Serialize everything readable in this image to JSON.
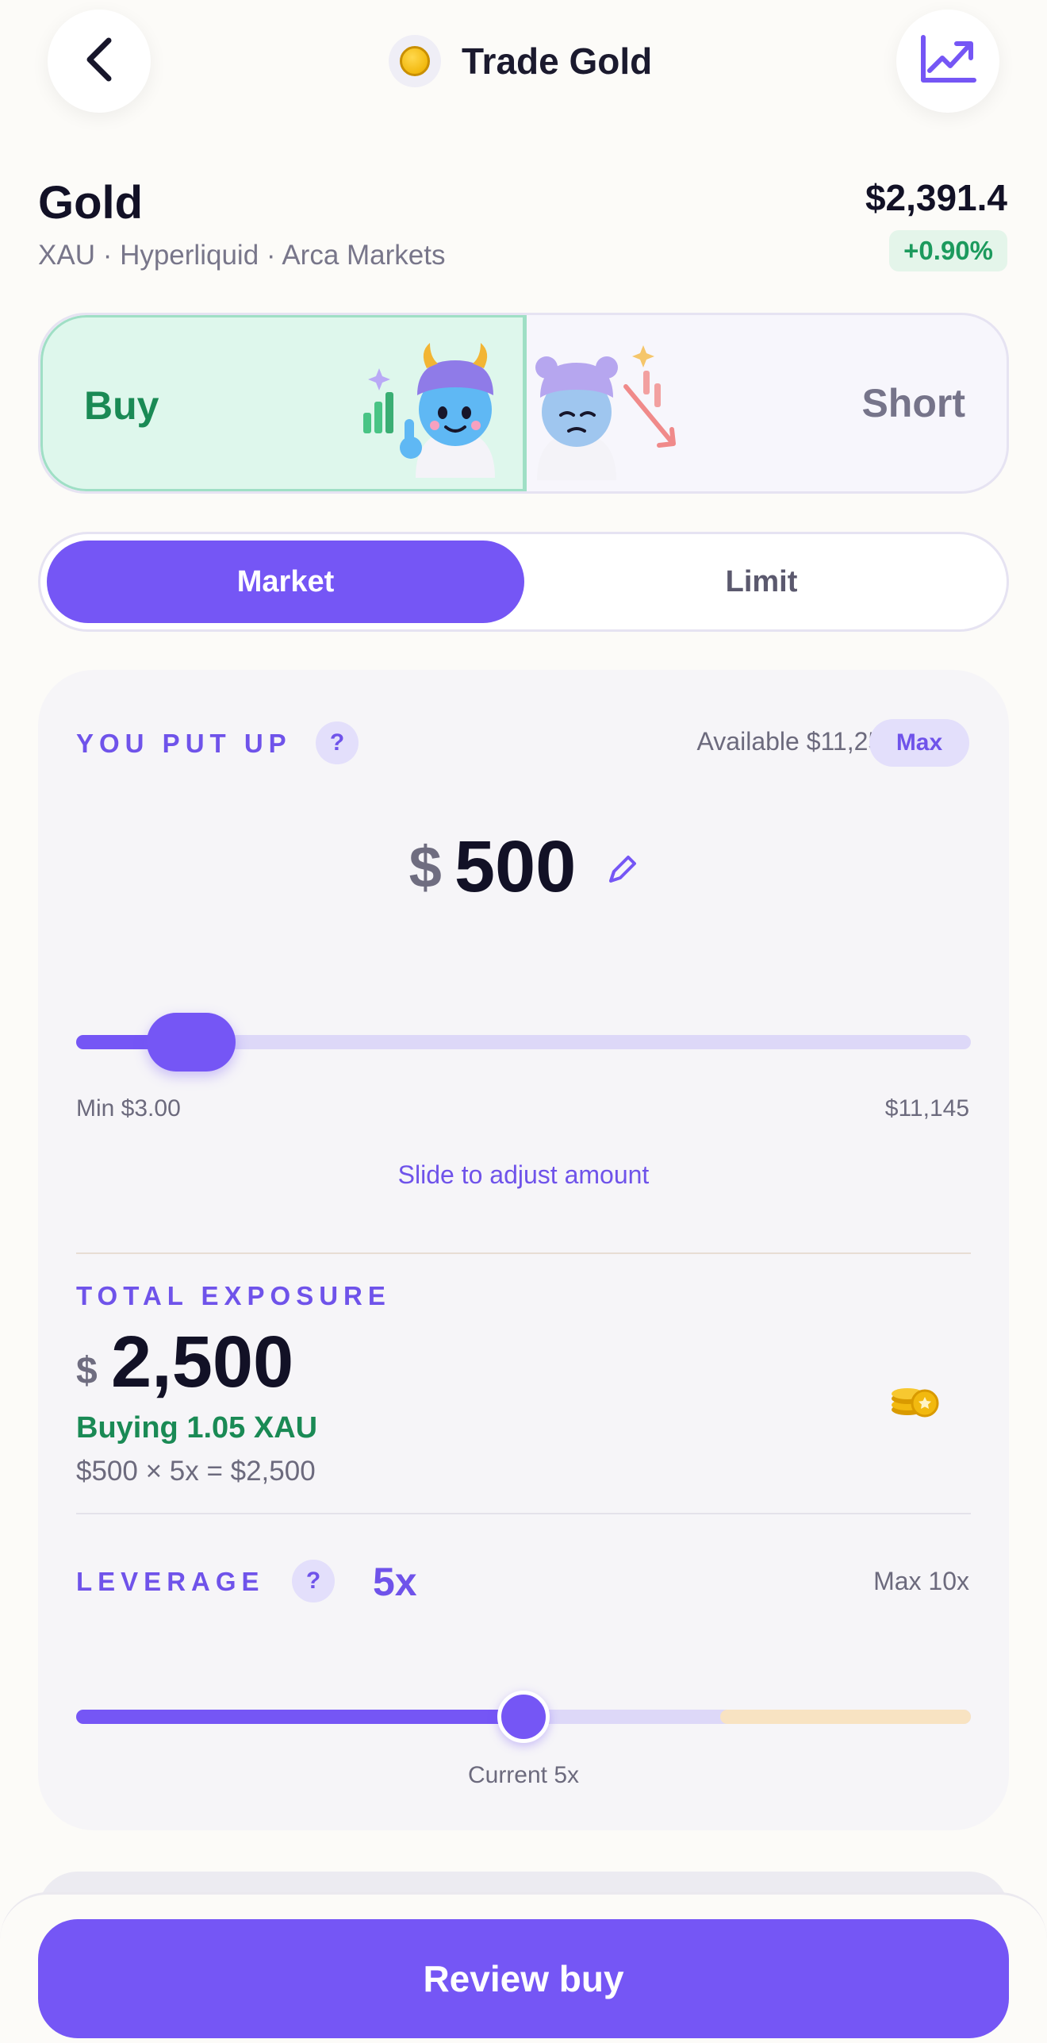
{
  "header": {
    "title": "Trade Gold",
    "back_icon": "chevron-left-icon",
    "chart_icon": "trending-up-icon",
    "coin_icon": "gold-coin-icon"
  },
  "asset": {
    "name": "Gold",
    "subtitle": "XAU · Hyperliquid · Arca Markets",
    "price": "$2,391.4",
    "change": "+0.90%"
  },
  "side_toggle": {
    "buy_label": "Buy",
    "short_label": "Short",
    "selected": "Buy"
  },
  "order_type": {
    "market_label": "Market",
    "limit_label": "Limit",
    "selected": "Market"
  },
  "put_up": {
    "label": "YOU PUT UP",
    "help": "?",
    "available": "Available $11,257",
    "max_label": "Max",
    "currency": "$",
    "amount": "500",
    "slider_min": "Min $3.00",
    "slider_max": "$11,145",
    "slider_hint": "Slide to adjust amount",
    "slider_fraction": 0.044
  },
  "exposure": {
    "label": "TOTAL EXPOSURE",
    "currency": "$",
    "value": "2,500",
    "buying": "Buying 1.05 XAU",
    "formula": "$500 × 5x = $2,500"
  },
  "leverage": {
    "label": "LEVERAGE",
    "help": "?",
    "value": "5x",
    "max": "Max 10x",
    "current": "Current 5x",
    "level": 5,
    "max_level": 10
  },
  "footer": {
    "review_label": "Review buy"
  },
  "colors": {
    "accent": "#7556f5",
    "buy_green": "#1a8a55",
    "buy_bg": "#def7ec",
    "danger_zone": "#f8e3c2"
  }
}
